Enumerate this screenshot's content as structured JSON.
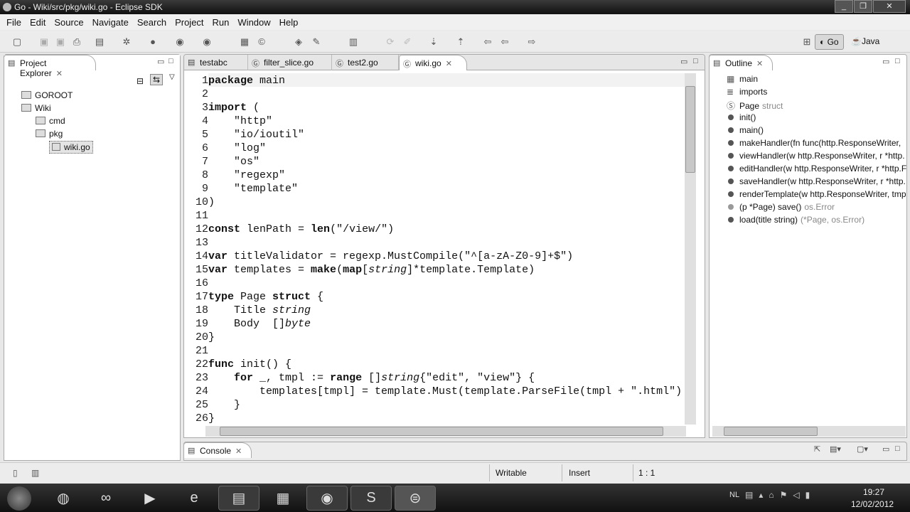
{
  "window": {
    "title": "Go - Wiki/src/pkg/wiki.go - Eclipse SDK"
  },
  "menu": [
    "File",
    "Edit",
    "Source",
    "Navigate",
    "Search",
    "Project",
    "Run",
    "Window",
    "Help"
  ],
  "perspectives": {
    "go": "Go",
    "java": "Java"
  },
  "project_explorer": {
    "title": "Project Explorer",
    "items": [
      {
        "label": "GOROOT",
        "indent": 1
      },
      {
        "label": "Wiki",
        "indent": 1
      },
      {
        "label": "cmd",
        "indent": 2
      },
      {
        "label": "pkg",
        "indent": 2
      },
      {
        "label": "wiki.go",
        "indent": 3
      }
    ]
  },
  "editor": {
    "tabs": [
      {
        "label": "testabc",
        "icon": "file-icon"
      },
      {
        "label": "filter_slice.go",
        "icon": "go-file-icon"
      },
      {
        "label": "test2.go",
        "icon": "go-file-icon"
      },
      {
        "label": "wiki.go",
        "icon": "go-file-icon",
        "active": true
      }
    ],
    "lines": [
      [
        [
          "package",
          "k"
        ],
        [
          " main",
          ""
        ]
      ],
      [],
      [
        [
          "import",
          "k"
        ],
        [
          " (",
          ""
        ]
      ],
      [
        [
          "    \"http\"",
          ""
        ]
      ],
      [
        [
          "    \"io/ioutil\"",
          ""
        ]
      ],
      [
        [
          "    \"log\"",
          ""
        ]
      ],
      [
        [
          "    \"os\"",
          ""
        ]
      ],
      [
        [
          "    \"regexp\"",
          ""
        ]
      ],
      [
        [
          "    \"template\"",
          ""
        ]
      ],
      [
        [
          ")",
          ""
        ]
      ],
      [],
      [
        [
          "const",
          "k"
        ],
        [
          " lenPath = ",
          ""
        ],
        [
          "len",
          "k"
        ],
        [
          "(\"/view/\")",
          ""
        ]
      ],
      [],
      [
        [
          "var",
          "k"
        ],
        [
          " titleValidator = regexp.MustCompile(\"^[a-zA-Z0-9]+$\")",
          ""
        ]
      ],
      [
        [
          "var",
          "k"
        ],
        [
          " templates = ",
          ""
        ],
        [
          "make",
          "k"
        ],
        [
          "(",
          ""
        ],
        [
          "map",
          "k"
        ],
        [
          "[",
          ""
        ],
        [
          "string",
          "t"
        ],
        [
          "]*template.Template)",
          ""
        ]
      ],
      [],
      [
        [
          "type",
          "k"
        ],
        [
          " Page ",
          ""
        ],
        [
          "struct",
          "k"
        ],
        [
          " {",
          ""
        ]
      ],
      [
        [
          "    Title ",
          ""
        ],
        [
          "string",
          "t"
        ]
      ],
      [
        [
          "    Body  []",
          ""
        ],
        [
          "byte",
          "t"
        ]
      ],
      [
        [
          "}",
          ""
        ]
      ],
      [],
      [
        [
          "func",
          "k"
        ],
        [
          " init() {",
          ""
        ]
      ],
      [
        [
          "    ",
          ""
        ],
        [
          "for",
          "k"
        ],
        [
          " _, tmpl := ",
          ""
        ],
        [
          "range",
          "k"
        ],
        [
          " []",
          ""
        ],
        [
          "string",
          "t"
        ],
        [
          "{\"edit\", \"view\"} {",
          ""
        ]
      ],
      [
        [
          "        templates[tmpl] = template.Must(template.ParseFile(tmpl + \".html\")",
          ""
        ]
      ],
      [
        [
          "    }",
          ""
        ]
      ],
      [
        [
          "}",
          ""
        ]
      ]
    ]
  },
  "outline": {
    "title": "Outline",
    "items": [
      {
        "label": "main",
        "suffix": "",
        "icon": "package-icon"
      },
      {
        "label": "imports",
        "suffix": "",
        "icon": "imports-icon"
      },
      {
        "label": "Page",
        "suffix": "struct",
        "icon": "struct-icon"
      },
      {
        "label": "init()",
        "suffix": "",
        "icon": "function-icon"
      },
      {
        "label": "main()",
        "suffix": "",
        "icon": "function-icon"
      },
      {
        "label": "makeHandler(fn func(http.ResponseWriter, ",
        "suffix": "",
        "icon": "function-icon"
      },
      {
        "label": "viewHandler(w http.ResponseWriter, r *http.",
        "suffix": "",
        "icon": "function-icon"
      },
      {
        "label": "editHandler(w http.ResponseWriter, r *http.F",
        "suffix": "",
        "icon": "function-icon"
      },
      {
        "label": "saveHandler(w http.ResponseWriter, r *http.",
        "suffix": "",
        "icon": "function-icon"
      },
      {
        "label": "renderTemplate(w http.ResponseWriter, tmp",
        "suffix": "",
        "icon": "function-icon"
      },
      {
        "label": "(p *Page) save()",
        "suffix": "os.Error",
        "icon": "method-icon"
      },
      {
        "label": "load(title string)",
        "suffix": "(*Page, os.Error)",
        "icon": "function-icon"
      }
    ]
  },
  "console": {
    "title": "Console"
  },
  "status": {
    "writable": "Writable",
    "insert": "Insert",
    "position": "1 : 1"
  },
  "taskbar": {
    "language": "NL",
    "time": "19:27",
    "date": "12/02/2012"
  }
}
